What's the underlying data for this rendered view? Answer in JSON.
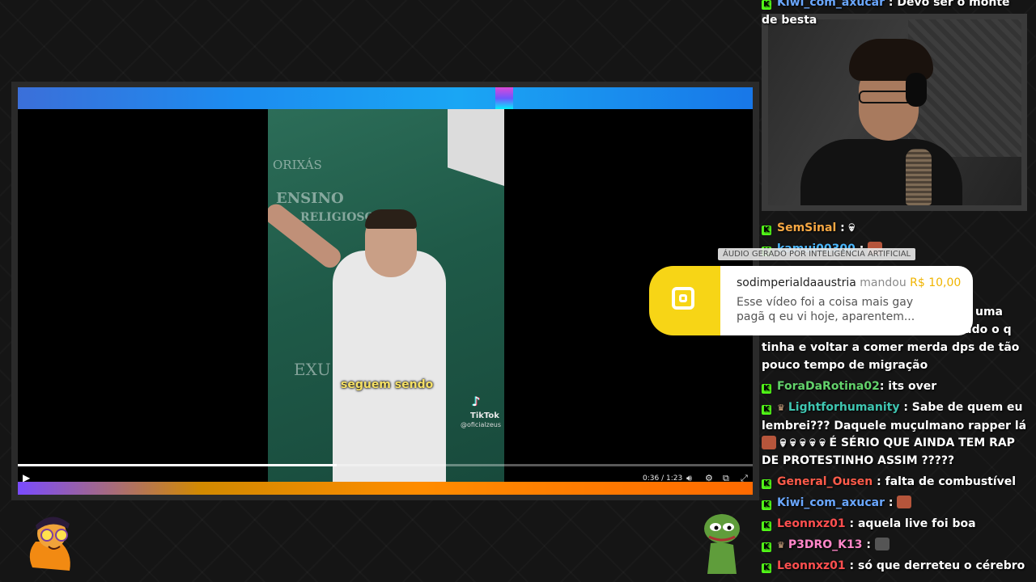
{
  "player": {
    "subtitle": "seguem sendo",
    "tiktok_brand": "TikTok",
    "tiktok_handle": "@oficialzeus",
    "current_time": "0:36",
    "duration": "1:23",
    "time_display": "0:36 / 1:23",
    "progress": 0.434,
    "chalkboard_text": [
      "ORIXÁS",
      "ENSINO",
      "RELIGIOSO",
      "EXU"
    ]
  },
  "ai_label": "ÁUDIO GERADO POR INTELIGÊNCIA ARTIFICIAL",
  "donation": {
    "username": "sodimperialdaaustria",
    "verb": "mandou",
    "amount": "R$ 10,00",
    "message": "Esse vídeo foi a coisa mais gay pagã q eu vi hoje, aparentem..."
  },
  "chat": {
    "messages": [
      {
        "user": "Kiwi_com_axucar",
        "color": "#6aa7ff",
        "text": ": Devo ser o monte de besta"
      },
      {
        "user": "SemSinal",
        "color": "#f7a843",
        "text": ":"
      },
      {
        "user": "kamui00300",
        "color": "#4bb8ff",
        "text": ":"
      },
      {
        "text_before_alert": "uma"
      },
      {
        "text_before_alert": "tudo o q"
      },
      {
        "continuation": "tinha e voltar a comer merda dps de tão pouco tempo de migração"
      },
      {
        "user": "ForaDaRotina02",
        "color": "#63d26b",
        "text": ": its over"
      },
      {
        "user": "Lightforhumanity",
        "color": "#3fc6b1",
        "text": ": Sabe de quem eu lembrei??? Daquele muçulmano rapper lá"
      },
      {
        "continuation": "É SÉRIO QUE AINDA TEM RAP DE PROTESTINHO ASSIM ?????"
      },
      {
        "user": "General_Ousen",
        "color": "#ff5b4a",
        "text": ": falta de combustível"
      },
      {
        "user": "Kiwi_com_axucar",
        "color": "#6aa7ff",
        "text": ":"
      },
      {
        "user": "Leonnxz01",
        "color": "#ff4f4f",
        "text": ": aquela live foi boa"
      },
      {
        "user": "P3DRO_K13",
        "color": "#ff86c8",
        "text": ":"
      },
      {
        "user": "Leonnxz01",
        "color": "#ff4f4f",
        "text": ": só que derreteu o cérebro"
      }
    ]
  },
  "colors": {
    "kick_green": "#53fc18",
    "alert_yellow": "#f7d516",
    "player_top_band": "#1aa6f4",
    "player_bottom_band": "#ff8c00"
  },
  "icons": [
    "play-icon",
    "volume-icon",
    "settings-icon",
    "pip-icon",
    "fullscreen-icon",
    "tiktok-icon",
    "kick-badge-icon",
    "donation-icon"
  ]
}
